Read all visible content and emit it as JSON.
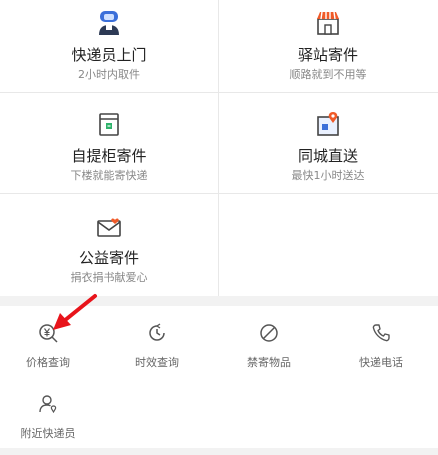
{
  "services": [
    {
      "title": "快递员上门",
      "subtitle": "2小时内取件",
      "icon": "courier-icon"
    },
    {
      "title": "驿站寄件",
      "subtitle": "顺路就到不用等",
      "icon": "station-icon"
    },
    {
      "title": "自提柜寄件",
      "subtitle": "下楼就能寄快递",
      "icon": "locker-icon"
    },
    {
      "title": "同城直送",
      "subtitle": "最快1小时送达",
      "icon": "city-map-icon"
    },
    {
      "title": "公益寄件",
      "subtitle": "捐衣捐书献爱心",
      "icon": "charity-envelope-icon"
    }
  ],
  "tools": [
    {
      "label": "价格查询",
      "icon": "yen-search-icon"
    },
    {
      "label": "时效查询",
      "icon": "clock-icon"
    },
    {
      "label": "禁寄物品",
      "icon": "prohibited-icon"
    },
    {
      "label": "快递电话",
      "icon": "phone-icon"
    },
    {
      "label": "附近快递员",
      "icon": "nearby-courier-icon"
    }
  ],
  "colors": {
    "accent": "#f05a28",
    "annotation_arrow": "#e8141b"
  }
}
